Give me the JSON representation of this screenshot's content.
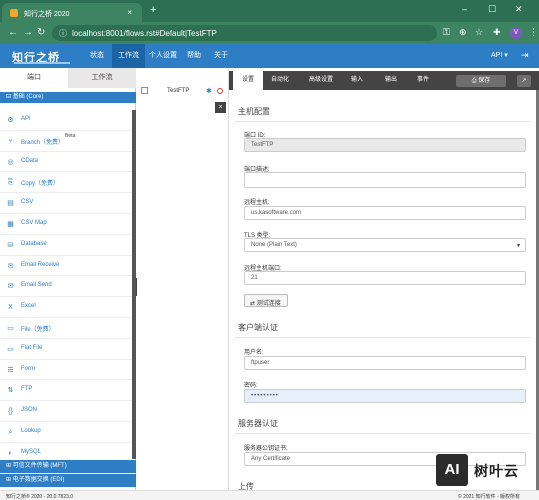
{
  "browser": {
    "tab_title": "知行之桥 2020",
    "tab_close": "×",
    "new_tab": "+",
    "url": "localhost:8001/flows.rst#Default|TestFTP",
    "profile_initial": "V",
    "window_controls": [
      "–",
      "☐",
      "✕"
    ]
  },
  "app": {
    "logo": "知行之桥",
    "menu": [
      {
        "label": "状态"
      },
      {
        "label": "工作流"
      },
      {
        "label": "个人设置"
      },
      {
        "label": "帮助"
      },
      {
        "label": "关于"
      }
    ],
    "api_label": "API ▾"
  },
  "left_panel": {
    "tabs": [
      "端口",
      "工作流"
    ],
    "category_top": "⊟ 基础 (Core)",
    "items": [
      {
        "icon": "api-icon",
        "glyph": "⚙",
        "label": "API"
      },
      {
        "icon": "branch-icon",
        "glyph": "⑂",
        "label": "Branch（免费）",
        "beta": "Beta"
      },
      {
        "icon": "cdata-icon",
        "glyph": "◎",
        "label": "CData"
      },
      {
        "icon": "copy-icon",
        "glyph": "⎘",
        "label": "Copy（免费）"
      },
      {
        "icon": "csv-icon",
        "glyph": "▤",
        "label": "CSV"
      },
      {
        "icon": "csv-map-icon",
        "glyph": "▦",
        "label": "CSV Map"
      },
      {
        "icon": "database-icon",
        "glyph": "⛁",
        "label": "Database"
      },
      {
        "icon": "email-receive-icon",
        "glyph": "✉",
        "label": "Email Receive"
      },
      {
        "icon": "email-send-icon",
        "glyph": "✉",
        "label": "Email Send"
      },
      {
        "icon": "excel-icon",
        "glyph": "X",
        "label": "Excel"
      },
      {
        "icon": "file-icon",
        "glyph": "▭",
        "label": "File（免费）"
      },
      {
        "icon": "flat-file-icon",
        "glyph": "▭",
        "label": "Flat File"
      },
      {
        "icon": "form-icon",
        "glyph": "☰",
        "label": "Form"
      },
      {
        "icon": "ftp-icon",
        "glyph": "⇅",
        "label": "FTP"
      },
      {
        "icon": "json-icon",
        "glyph": "{}",
        "label": "JSON"
      },
      {
        "icon": "lookup-icon",
        "glyph": "⌕",
        "label": "Lookup"
      },
      {
        "icon": "mysql-icon",
        "glyph": "◐",
        "label": "MySQL"
      }
    ],
    "category_bottom": [
      "⊞ 可信文件传输 (MFT)",
      "⊞ 电子数据交换 (EDI)"
    ]
  },
  "canvas": {
    "node_label": "TestFTP",
    "close_label": "×",
    "collapse_label": "❮"
  },
  "properties": {
    "tabs": [
      "设置",
      "自动化",
      "高级设置",
      "输入",
      "输出",
      "事件"
    ],
    "save_label": "⎙ 保存",
    "pop_label": "↗",
    "host_section": "主机配置",
    "port_id_label": "端口 ID:",
    "port_id_value": "TestFTP",
    "port_desc_label": "端口描述:",
    "port_desc_value": "",
    "remote_host_label": "远程主机:",
    "remote_host_value": "us.kasoftware.com",
    "tls_label": "TLS 类型:",
    "tls_value": "None (Plain Text)",
    "remote_port_label": "远程主机端口:",
    "remote_port_value": "21",
    "test_label": "⇄ 测试连接",
    "client_section": "客户端认证",
    "user_label": "用户名:",
    "user_value": "ftpuser",
    "pw_label": "密码:",
    "pw_value": "•••••••••",
    "server_section": "服务器认证",
    "cert_label": "服务器公钥证书:",
    "cert_value": "Any Certificate",
    "next_section": "上传"
  },
  "footer": {
    "left": "知行之桥® 2020 - 20.0.7823.0",
    "right": "© 2021 知行软件 - 版权所有"
  },
  "watermark": {
    "box": "AI",
    "text": "树叶云"
  }
}
